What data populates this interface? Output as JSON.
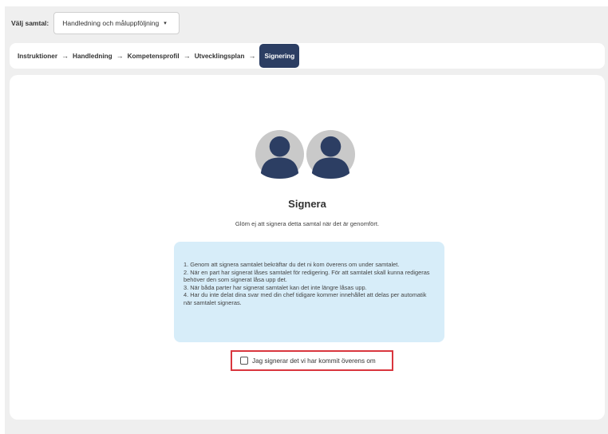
{
  "selector": {
    "label": "Välj samtal:",
    "value": "Handledning och måluppföljning",
    "caret": "▾"
  },
  "breadcrumb": {
    "arrow": "→",
    "steps": [
      "Instruktioner",
      "Handledning",
      "Kompetensprofil",
      "Utvecklingsplan",
      "Signering"
    ],
    "active_index": 4
  },
  "sign": {
    "title": "Signera",
    "subtitle": "Glöm ej att signera detta samtal när det är genomfört.",
    "info_items": [
      "1. Genom att signera samtalet bekräftar du det ni kom överens om under samtalet.",
      "2. När en part har signerat låses samtalet för redigering. För att samtalet skall kunna redigeras behöver den som signerat låsa upp det.",
      "3. När båda parter har signerat samtalet kan det inte längre låsas upp.",
      "4. Har du inte delat dina svar med din chef tidigare kommer innehållet att delas per automatik när samtalet signeras."
    ],
    "checkbox_label": "Jag signerar det vi har kommit överens om",
    "checkbox_checked": false
  },
  "colors": {
    "accent": "#2c3e63",
    "info_bg": "#d7edf9",
    "highlight_border": "#d9363e",
    "avatar_bg": "#c9c9c9",
    "avatar_fg": "#2c3e63"
  },
  "icons": [
    "user-avatar-icon",
    "user-avatar-icon",
    "checkbox-icon"
  ]
}
